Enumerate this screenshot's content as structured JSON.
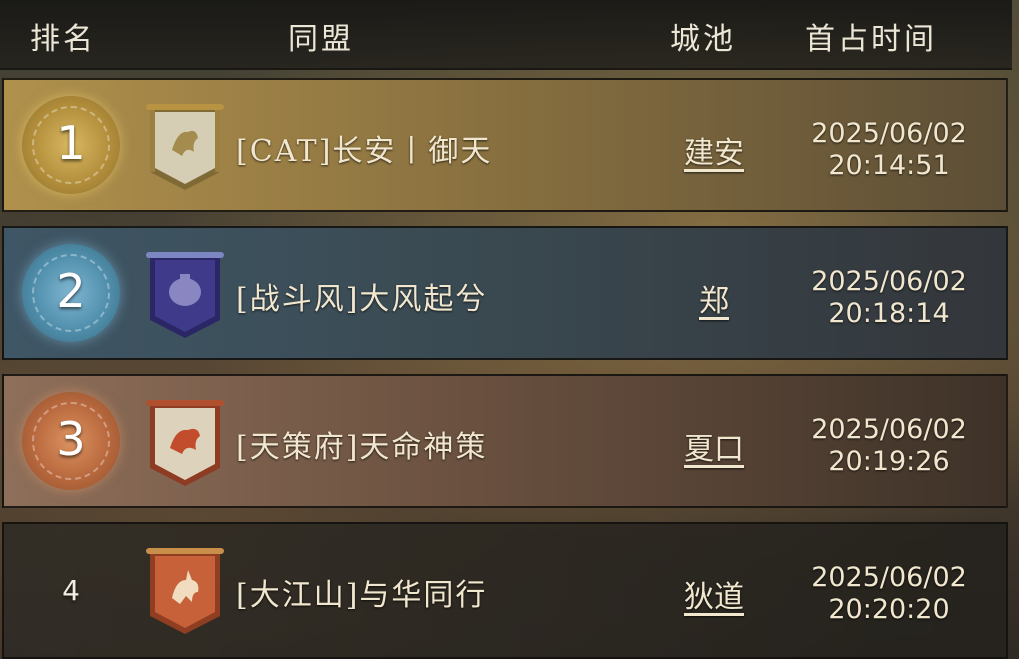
{
  "header": {
    "rank": "排名",
    "alliance": "同盟",
    "city": "城池",
    "first_time": "首占时间"
  },
  "rows": [
    {
      "rank": "1",
      "alliance": "[CAT]长安丨御天",
      "city": "建安",
      "date": "2025/06/02",
      "time": "20:14:51",
      "medal": "gold-dragon-medal",
      "banner_color": "#c9b58a",
      "banner_icon": "qilin-icon"
    },
    {
      "rank": "2",
      "alliance": "[战斗风]大风起兮",
      "city": "郑",
      "date": "2025/06/02",
      "time": "20:18:14",
      "medal": "blue-dragon-medal",
      "banner_color": "#3f3a8a",
      "banner_icon": "helmet-icon"
    },
    {
      "rank": "3",
      "alliance": "[天策府]天命神策",
      "city": "夏口",
      "date": "2025/06/02",
      "time": "20:19:26",
      "medal": "bronze-dragon-medal",
      "banner_color": "#d8cdb8",
      "banner_icon": "qilin-icon"
    },
    {
      "rank": "4",
      "alliance": "[大江山]与华同行",
      "city": "狄道",
      "date": "2025/06/02",
      "time": "20:20:20",
      "medal": "",
      "banner_color": "#c6613a",
      "banner_icon": "deer-icon"
    }
  ]
}
